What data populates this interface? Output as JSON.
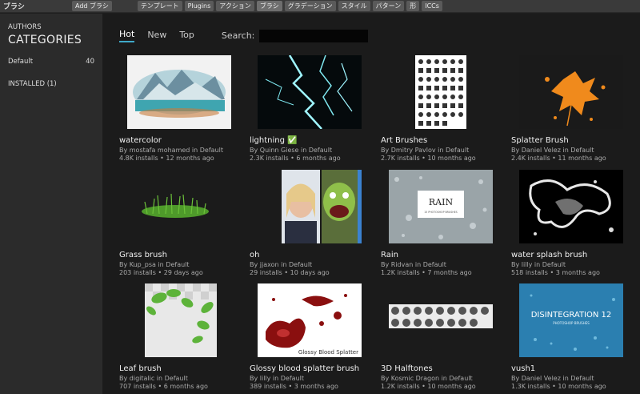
{
  "topbar": {
    "title": "ブラシ",
    "add_button": "Add ブラシ",
    "tabs": [
      "テンプレート",
      "Plugins",
      "アクション",
      "ブラシ",
      "グラデーション",
      "スタイル",
      "パターン",
      "形",
      "ICCs"
    ]
  },
  "sidebar": {
    "authors": "AUTHORS",
    "categories": "CATEGORIES",
    "category": {
      "label": "Default",
      "count": "40"
    },
    "installed": "INSTALLED (1)"
  },
  "filters": {
    "hot": "Hot",
    "new": "New",
    "top": "Top",
    "search_label": "Search:"
  },
  "brushes": [
    {
      "name": "watercolor",
      "by": "By mostafa mohamed in Default",
      "meta": "4.8K installs • 12 months ago",
      "thumb": "watercolor-thumb"
    },
    {
      "name": "lightning ✅",
      "by": "By Quinn Giese in Default",
      "meta": "2.3K installs • 6 months ago",
      "thumb": "lightning-thumb"
    },
    {
      "name": "Art Brushes",
      "by": "By Dmitry Pavlov in Default",
      "meta": "2.7K installs • 10 months ago",
      "thumb": "art-brushes-thumb"
    },
    {
      "name": "Splatter Brush",
      "by": "By Daniel Velez in Default",
      "meta": "2.4K installs • 11 months ago",
      "thumb": "splatter-thumb"
    },
    {
      "name": "Grass brush",
      "by": "By Kup_psa in Default",
      "meta": "203 installs • 29 days ago",
      "thumb": "grass-thumb"
    },
    {
      "name": "oh",
      "by": "By jjaxon in Default",
      "meta": "29 installs • 10 days ago",
      "thumb": "oh-thumb"
    },
    {
      "name": "Rain",
      "by": "By Ridvan in Default",
      "meta": "1.2K installs • 7 months ago",
      "thumb": "rain-thumb"
    },
    {
      "name": "water splash brush",
      "by": "By lilly in Default",
      "meta": "518 installs • 3 months ago",
      "thumb": "water-splash-thumb"
    },
    {
      "name": "Leaf brush",
      "by": "By digitalic in Default",
      "meta": "707 installs • 6 months ago",
      "thumb": "leaf-thumb"
    },
    {
      "name": "Glossy blood splatter brush",
      "by": "By lilly in Default",
      "meta": "389 installs • 3 months ago",
      "thumb": "blood-thumb"
    },
    {
      "name": "3D Halftones",
      "by": "By Kosmic Dragon in Default",
      "meta": "1.2K installs • 10 months ago",
      "thumb": "halftone-thumb"
    },
    {
      "name": "vush1",
      "by": "By Daniel Velez in Default",
      "meta": "1.3K installs • 10 months ago",
      "thumb": "vush-thumb"
    }
  ],
  "thumb_text": {
    "rain_title": "RAIN",
    "rain_sub": "15 PHOTOSHOP BRUSHES",
    "blood_caption": "Glossy Blood Splatter",
    "vush_title": "DISINTEGRATION 12",
    "vush_sub": "PHOTOSHOP BRUSHES"
  }
}
